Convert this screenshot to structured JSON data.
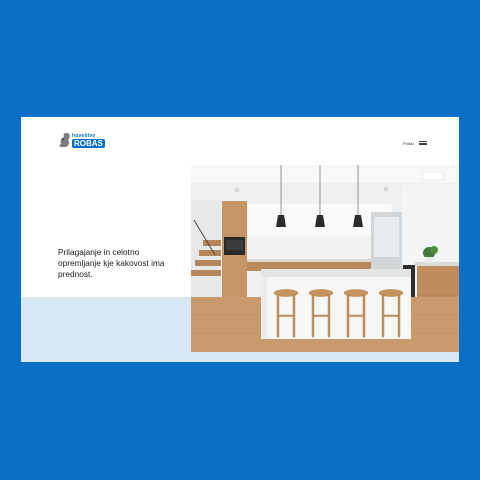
{
  "brand": {
    "logo_top": "hoveštvo",
    "logo_main": "ROBAS"
  },
  "nav": {
    "language": "Polski"
  },
  "hero": {
    "headline": "Prilagajanje in celotno opremljanje kje kakovost ima prednost."
  },
  "colors": {
    "background": "#0A6FC6",
    "card": "#FFFFFF",
    "band": "#D7E7F3"
  }
}
